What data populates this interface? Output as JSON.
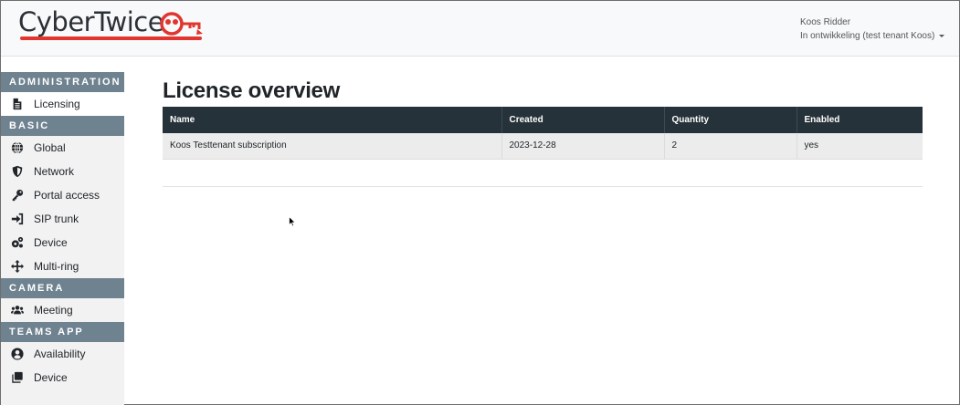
{
  "header": {
    "logo_text": "CyberTwice",
    "user_name": "Koos Ridder",
    "tenant": "In ontwikkeling (test tenant Koos)"
  },
  "colors": {
    "accent": "#e0362f",
    "section_header": "#6f8290",
    "table_header": "#26323a"
  },
  "sidebar": {
    "sections": [
      {
        "title": "Administration",
        "items": [
          {
            "label": "Licensing",
            "icon": "file-icon",
            "active": true
          }
        ]
      },
      {
        "title": "Basic",
        "items": [
          {
            "label": "Global",
            "icon": "globe-icon"
          },
          {
            "label": "Network",
            "icon": "shield-icon"
          },
          {
            "label": "Portal access",
            "icon": "key-icon"
          },
          {
            "label": "SIP trunk",
            "icon": "sign-in-icon"
          },
          {
            "label": "Device",
            "icon": "cogs-icon"
          },
          {
            "label": "Multi-ring",
            "icon": "arrows-icon"
          }
        ]
      },
      {
        "title": "Camera",
        "items": [
          {
            "label": "Meeting",
            "icon": "users-icon"
          }
        ]
      },
      {
        "title": "Teams App",
        "items": [
          {
            "label": "Availability",
            "icon": "user-circle-icon"
          },
          {
            "label": "Device",
            "icon": "copy-icon"
          }
        ]
      }
    ]
  },
  "main": {
    "title": "License overview",
    "table": {
      "columns": [
        "Name",
        "Created",
        "Quantity",
        "Enabled"
      ],
      "rows": [
        [
          "Koos Testtenant subscription",
          "2023-12-28",
          "2",
          "yes"
        ]
      ]
    }
  }
}
